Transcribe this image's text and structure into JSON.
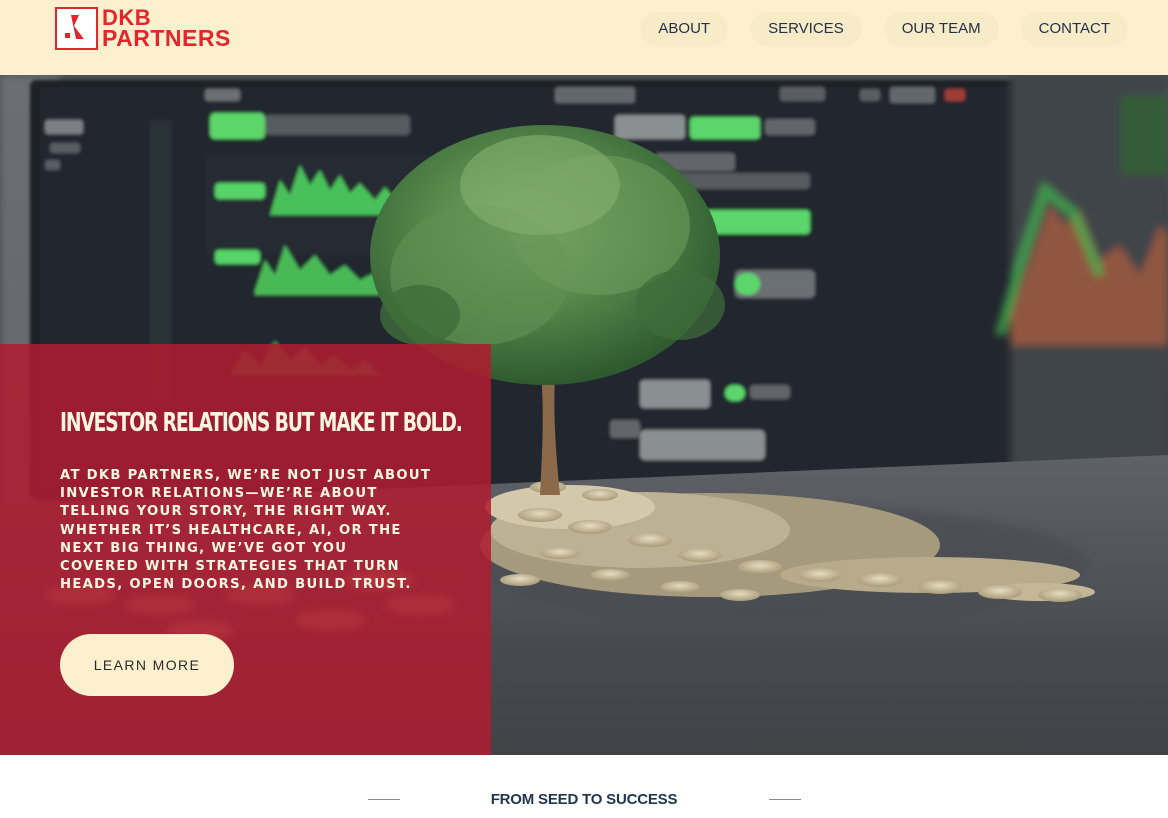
{
  "brand": {
    "line1": "DKB",
    "line2": "PARTNERS",
    "color": "#e3262b",
    "icon": "dkb-k-mark-icon"
  },
  "nav": {
    "items": [
      {
        "label": "ABOUT"
      },
      {
        "label": "SERVICES"
      },
      {
        "label": "OUR TEAM"
      },
      {
        "label": "CONTACT"
      }
    ]
  },
  "hero": {
    "title": "INVESTOR RELATIONS BUT MAKE IT BOLD.",
    "body": "AT DKB PARTNERS, WE’RE NOT JUST ABOUT INVESTOR RELATIONS—WE’RE ABOUT TELLING YOUR STORY, THE RIGHT WAY. WHETHER IT’S HEALTHCARE, AI, OR THE NEXT BIG THING, WE’VE GOT YOU COVERED WITH STRATEGIES THAT TURN HEADS, OPEN DOORS, AND BUILD TRUST.",
    "cta_label": "LEARN MORE",
    "background": "money-tree-on-coins-with-stock-charts-image",
    "panel_color": "#b01c30"
  },
  "section": {
    "heading": "FROM SEED TO SUCCESS"
  },
  "colors": {
    "header_bg": "#fcf0cf",
    "text_dark": "#22304a",
    "heading_navy": "#1f3550"
  }
}
